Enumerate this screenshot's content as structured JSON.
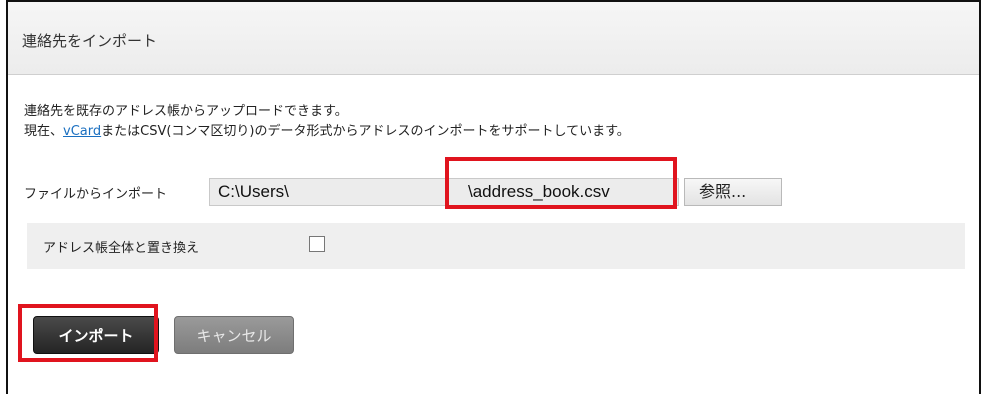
{
  "header": {
    "title": "連絡先をインポート"
  },
  "description": {
    "line1": "連絡先を既存のアドレス帳からアップロードできます。",
    "line2_prefix": "現在、",
    "line2_link": "vCard",
    "line2_suffix": "またはCSV(コンマ区切り)のデータ形式からアドレスのインポートをサポートしています。"
  },
  "file_import": {
    "label": "ファイルからインポート",
    "path_start": "C:\\Users\\",
    "path_end": "\\address_book.csv",
    "browse_label": "参照..."
  },
  "replace_option": {
    "label": "アドレス帳全体と置き換え",
    "checked": false
  },
  "actions": {
    "import_label": "インポート",
    "cancel_label": "キャンセル"
  },
  "colors": {
    "highlight": "#e0141e",
    "link": "#1a6fc0",
    "primary_button": "#333333",
    "secondary_button": "#8a8a8a"
  }
}
